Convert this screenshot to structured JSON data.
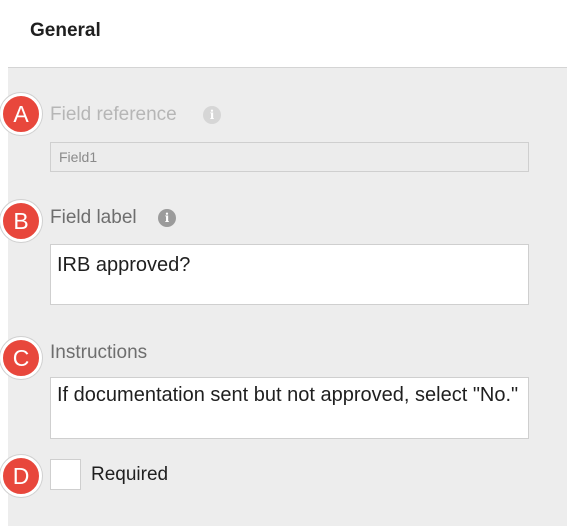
{
  "header": {
    "title": "General"
  },
  "fields": {
    "reference": {
      "marker": "A",
      "label": "Field reference",
      "value": "Field1",
      "info_icon": "info-icon"
    },
    "label": {
      "marker": "B",
      "label": "Field label",
      "value": "IRB approved?",
      "info_icon": "info-icon"
    },
    "instructions": {
      "marker": "C",
      "label": "Instructions",
      "value": "If documentation sent but not approved, select \"No.\""
    },
    "required": {
      "marker": "D",
      "label": "Required",
      "checked": false
    }
  },
  "colors": {
    "marker": "#e8473c",
    "panel_background": "#ededed",
    "muted_label": "#b6b6b6",
    "label": "#6e6e6e"
  }
}
